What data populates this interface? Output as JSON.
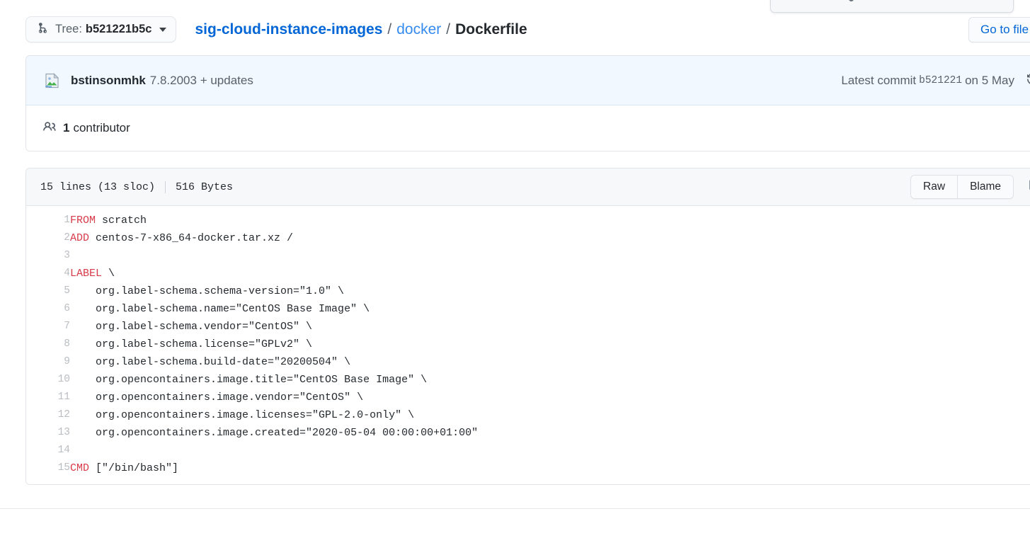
{
  "top_popover": {
    "visible": true
  },
  "goto_file": {
    "label": "Go to file"
  },
  "tree": {
    "branch_icon": "git-branch-icon",
    "label": "Tree:",
    "sha": "b521221b5c",
    "caret_icon": "chevron-down-icon"
  },
  "breadcrumb": {
    "repo": "sig-cloud-instance-images",
    "sep": "/",
    "dir": "docker",
    "file": "Dockerfile"
  },
  "commit": {
    "avatar_icon": "broken-image-avatar-icon",
    "author": "bstinsonmhk",
    "message": "7.8.2003 + updates",
    "latest_prefix": "Latest commit",
    "sha": "b521221",
    "date": "on 5 May",
    "history_icon": "history-icon"
  },
  "contributors": {
    "icon": "people-icon",
    "count": "1",
    "label": "contributor"
  },
  "blob": {
    "lines_info": "15 lines (13 sloc)",
    "size": "516 Bytes",
    "raw_label": "Raw",
    "blame_label": "Blame",
    "desktop_icon": "desktop-download-icon",
    "code": [
      {
        "n": "1",
        "kw": "FROM",
        "rest": " scratch"
      },
      {
        "n": "2",
        "kw": "ADD",
        "rest": " centos-7-x86_64-docker.tar.xz /"
      },
      {
        "n": "3",
        "kw": "",
        "rest": ""
      },
      {
        "n": "4",
        "kw": "LABEL",
        "rest": " \\"
      },
      {
        "n": "5",
        "kw": "",
        "rest": "    org.label-schema.schema-version=\"1.0\" \\"
      },
      {
        "n": "6",
        "kw": "",
        "rest": "    org.label-schema.name=\"CentOS Base Image\" \\"
      },
      {
        "n": "7",
        "kw": "",
        "rest": "    org.label-schema.vendor=\"CentOS\" \\"
      },
      {
        "n": "8",
        "kw": "",
        "rest": "    org.label-schema.license=\"GPLv2\" \\"
      },
      {
        "n": "9",
        "kw": "",
        "rest": "    org.label-schema.build-date=\"20200504\" \\"
      },
      {
        "n": "10",
        "kw": "",
        "rest": "    org.opencontainers.image.title=\"CentOS Base Image\" \\"
      },
      {
        "n": "11",
        "kw": "",
        "rest": "    org.opencontainers.image.vendor=\"CentOS\" \\"
      },
      {
        "n": "12",
        "kw": "",
        "rest": "    org.opencontainers.image.licenses=\"GPL-2.0-only\" \\"
      },
      {
        "n": "13",
        "kw": "",
        "rest": "    org.opencontainers.image.created=\"2020-05-04 00:00:00+01:00\""
      },
      {
        "n": "14",
        "kw": "",
        "rest": ""
      },
      {
        "n": "15",
        "kw": "CMD",
        "rest": " [\"/bin/bash\"]"
      }
    ]
  },
  "colors": {
    "link": "#0366d6",
    "keyword": "#d73a49",
    "commit_bar_bg": "#f1f8ff",
    "header_bg": "#f6f8fa",
    "border": "#e1e4e8"
  }
}
